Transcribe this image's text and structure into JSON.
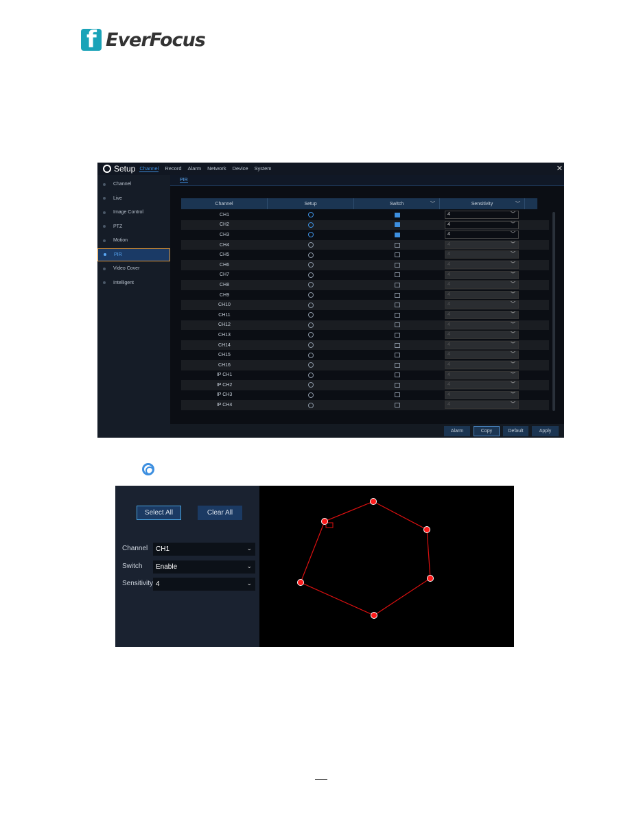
{
  "logo": {
    "text": "EverFocus"
  },
  "setup_screen": {
    "title": "Setup",
    "tabs": [
      "Channel",
      "Record",
      "Alarm",
      "Network",
      "Device",
      "System"
    ],
    "active_tab": "Channel",
    "sidebar": [
      "Channel",
      "Live",
      "Image Control",
      "PTZ",
      "Motion",
      "PIR",
      "Video Cover",
      "Intelligent"
    ],
    "selected_sidebar": "PIR",
    "subtab": "PIR",
    "columns": [
      "Channel",
      "Setup",
      "Switch",
      "Sensitivity"
    ],
    "rows": [
      {
        "channel": "CH1",
        "switch": true,
        "sensitivity": "4"
      },
      {
        "channel": "CH2",
        "switch": true,
        "sensitivity": "4"
      },
      {
        "channel": "CH3",
        "switch": true,
        "sensitivity": "4"
      },
      {
        "channel": "CH4",
        "switch": false,
        "sensitivity": "4"
      },
      {
        "channel": "CH5",
        "switch": false,
        "sensitivity": "4"
      },
      {
        "channel": "CH6",
        "switch": false,
        "sensitivity": "4"
      },
      {
        "channel": "CH7",
        "switch": false,
        "sensitivity": "4"
      },
      {
        "channel": "CH8",
        "switch": false,
        "sensitivity": "4"
      },
      {
        "channel": "CH9",
        "switch": false,
        "sensitivity": "4"
      },
      {
        "channel": "CH10",
        "switch": false,
        "sensitivity": "4"
      },
      {
        "channel": "CH11",
        "switch": false,
        "sensitivity": "4"
      },
      {
        "channel": "CH12",
        "switch": false,
        "sensitivity": "4"
      },
      {
        "channel": "CH13",
        "switch": false,
        "sensitivity": "4"
      },
      {
        "channel": "CH14",
        "switch": false,
        "sensitivity": "4"
      },
      {
        "channel": "CH15",
        "switch": false,
        "sensitivity": "4"
      },
      {
        "channel": "CH16",
        "switch": false,
        "sensitivity": "4"
      },
      {
        "channel": "IP CH1",
        "switch": false,
        "sensitivity": "4"
      },
      {
        "channel": "IP CH2",
        "switch": false,
        "sensitivity": "4"
      },
      {
        "channel": "IP CH3",
        "switch": false,
        "sensitivity": "4"
      },
      {
        "channel": "IP CH4",
        "switch": false,
        "sensitivity": "4"
      }
    ],
    "buttons": [
      "Alarm",
      "Copy",
      "Default",
      "Apply"
    ],
    "focused_button": "Copy",
    "accent": "#3d8fe0"
  },
  "pir_setup": {
    "select_all": "Select All",
    "clear_all": "Clear All",
    "fields": [
      {
        "label": "Channel",
        "value": "CH1"
      },
      {
        "label": "Switch",
        "value": "Enable"
      },
      {
        "label": "Sensitivity",
        "value": "4"
      }
    ],
    "region_color": "#ff0000"
  }
}
